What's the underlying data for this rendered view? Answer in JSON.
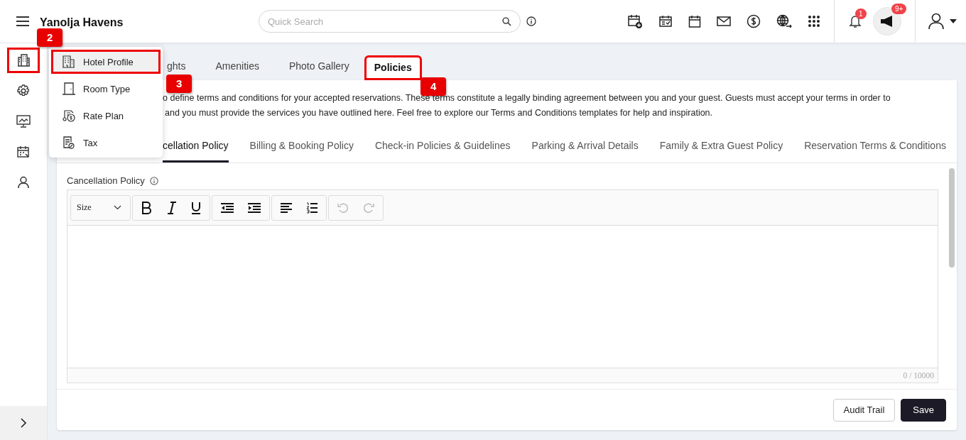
{
  "header": {
    "title": "Yanolja Havens",
    "search": {
      "placeholder": "Quick Search"
    },
    "notifications": {
      "count": "1"
    },
    "announcements": {
      "count": "9+"
    }
  },
  "sidebar": {
    "items": [
      {
        "kind": "building",
        "highlighted": true
      },
      {
        "kind": "settings",
        "highlighted": false
      },
      {
        "kind": "monitor",
        "highlighted": false
      },
      {
        "kind": "calendar",
        "highlighted": false
      },
      {
        "kind": "user",
        "highlighted": false
      }
    ]
  },
  "menu": {
    "items": [
      {
        "label": "Hotel Profile",
        "kind": "building",
        "selected": true,
        "highlighted": true
      },
      {
        "label": "Room Type",
        "kind": "door",
        "selected": false,
        "highlighted": false
      },
      {
        "label": "Rate Plan",
        "kind": "rate",
        "selected": false,
        "highlighted": false
      },
      {
        "label": "Tax",
        "kind": "tax",
        "selected": false,
        "highlighted": false
      }
    ]
  },
  "tabs": [
    {
      "label": "ghts",
      "selected": false,
      "highlighted": false
    },
    {
      "label": "Amenities",
      "selected": false,
      "highlighted": false
    },
    {
      "label": "Photo Gallery",
      "selected": false,
      "highlighted": false
    },
    {
      "label": "Policies",
      "selected": true,
      "highlighted": true
    }
  ],
  "description": [
    "o define terms and conditions for your accepted reservations. These terms constitute a legally binding agreement between you and your guest. Guests must accept your terms in order to",
    "and you must provide the services you have outlined here. Feel free to explore our Terms and Conditions templates for help and inspiration."
  ],
  "policy_tabs": [
    {
      "label": "cellation Policy",
      "selected": true
    },
    {
      "label": "Billing & Booking Policy",
      "selected": false
    },
    {
      "label": "Check-in Policies & Guidelines",
      "selected": false
    },
    {
      "label": "Parking & Arrival Details",
      "selected": false
    },
    {
      "label": "Family & Extra Guest Policy",
      "selected": false
    },
    {
      "label": "Reservation Terms & Conditions",
      "selected": false
    }
  ],
  "editor": {
    "label": "Cancellation Policy",
    "size_select": "Size",
    "char_count": "0 / 10000"
  },
  "buttons": [
    {
      "label": "Audit Trail",
      "kind": "secondary"
    },
    {
      "label": "Save",
      "kind": "primary"
    }
  ],
  "annotations": [
    {
      "label": "2"
    },
    {
      "label": "3"
    },
    {
      "label": "4"
    }
  ]
}
